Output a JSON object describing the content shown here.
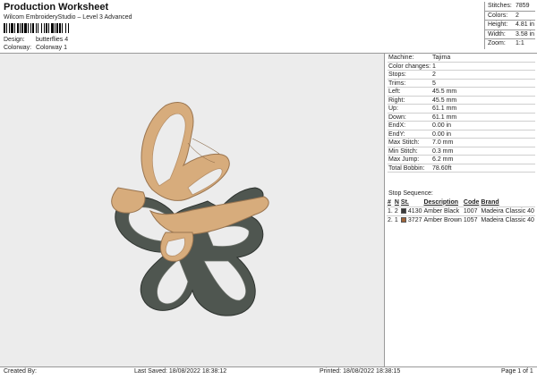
{
  "header": {
    "title": "Production Worksheet",
    "subtitle": "Wilcom EmbroideryStudio – Level 3 Advanced",
    "design_label": "Design:",
    "design_value": "butterflies 4",
    "colorway_label": "Colorway:",
    "colorway_value": "Colorway 1"
  },
  "summary": [
    {
      "label": "Stitches:",
      "value": "7859"
    },
    {
      "label": "Colors:",
      "value": "2"
    },
    {
      "label": "Height:",
      "value": "4.81 in"
    },
    {
      "label": "Width:",
      "value": "3.58 in"
    },
    {
      "label": "Zoom:",
      "value": "1:1"
    }
  ],
  "specs": [
    {
      "label": "Machine:",
      "value": "Tajima"
    },
    {
      "label": "Color changes:",
      "value": "1"
    },
    {
      "label": "Stops:",
      "value": "2"
    },
    {
      "label": "Trims:",
      "value": "5"
    },
    {
      "label": "Left:",
      "value": "45.5 mm"
    },
    {
      "label": "Right:",
      "value": "45.5 mm"
    },
    {
      "label": "Up:",
      "value": "61.1 mm"
    },
    {
      "label": "Down:",
      "value": "61.1 mm"
    },
    {
      "label": "EndX:",
      "value": "0.00 in"
    },
    {
      "label": "EndY:",
      "value": "0.00 in"
    },
    {
      "label": "Max Stitch:",
      "value": "7.0 mm"
    },
    {
      "label": "Min Stitch:",
      "value": "0.3 mm"
    },
    {
      "label": "Max Jump:",
      "value": "6.2 mm"
    },
    {
      "label": "Total Bobbin:",
      "value": "78.60ft"
    }
  ],
  "stop_sequence": {
    "title": "Stop Sequence:",
    "headers": [
      "#",
      "N",
      "St.",
      "Description",
      "Code",
      "Brand"
    ],
    "rows": [
      {
        "num": "1.",
        "n": "2",
        "st": "4130",
        "description": "Amber Black",
        "code": "1007",
        "brand": "Madeira Classic 40",
        "color": "#3a3a3a"
      },
      {
        "num": "2.",
        "n": "1",
        "st": "3727",
        "description": "Amber Brown",
        "code": "1057",
        "brand": "Madeira Classic 40",
        "color": "#a0653a"
      }
    ]
  },
  "footer": {
    "created_by": "Created By:",
    "last_saved": "Last Saved: 18/08/2022 18:38:12",
    "printed": "Printed: 18/08/2022 18:38:15",
    "page": "Page 1 of 1"
  },
  "colors": {
    "preview_background": "#ececec",
    "thread_dark": "#4f5650",
    "thread_tan": "#d7ac7c"
  }
}
